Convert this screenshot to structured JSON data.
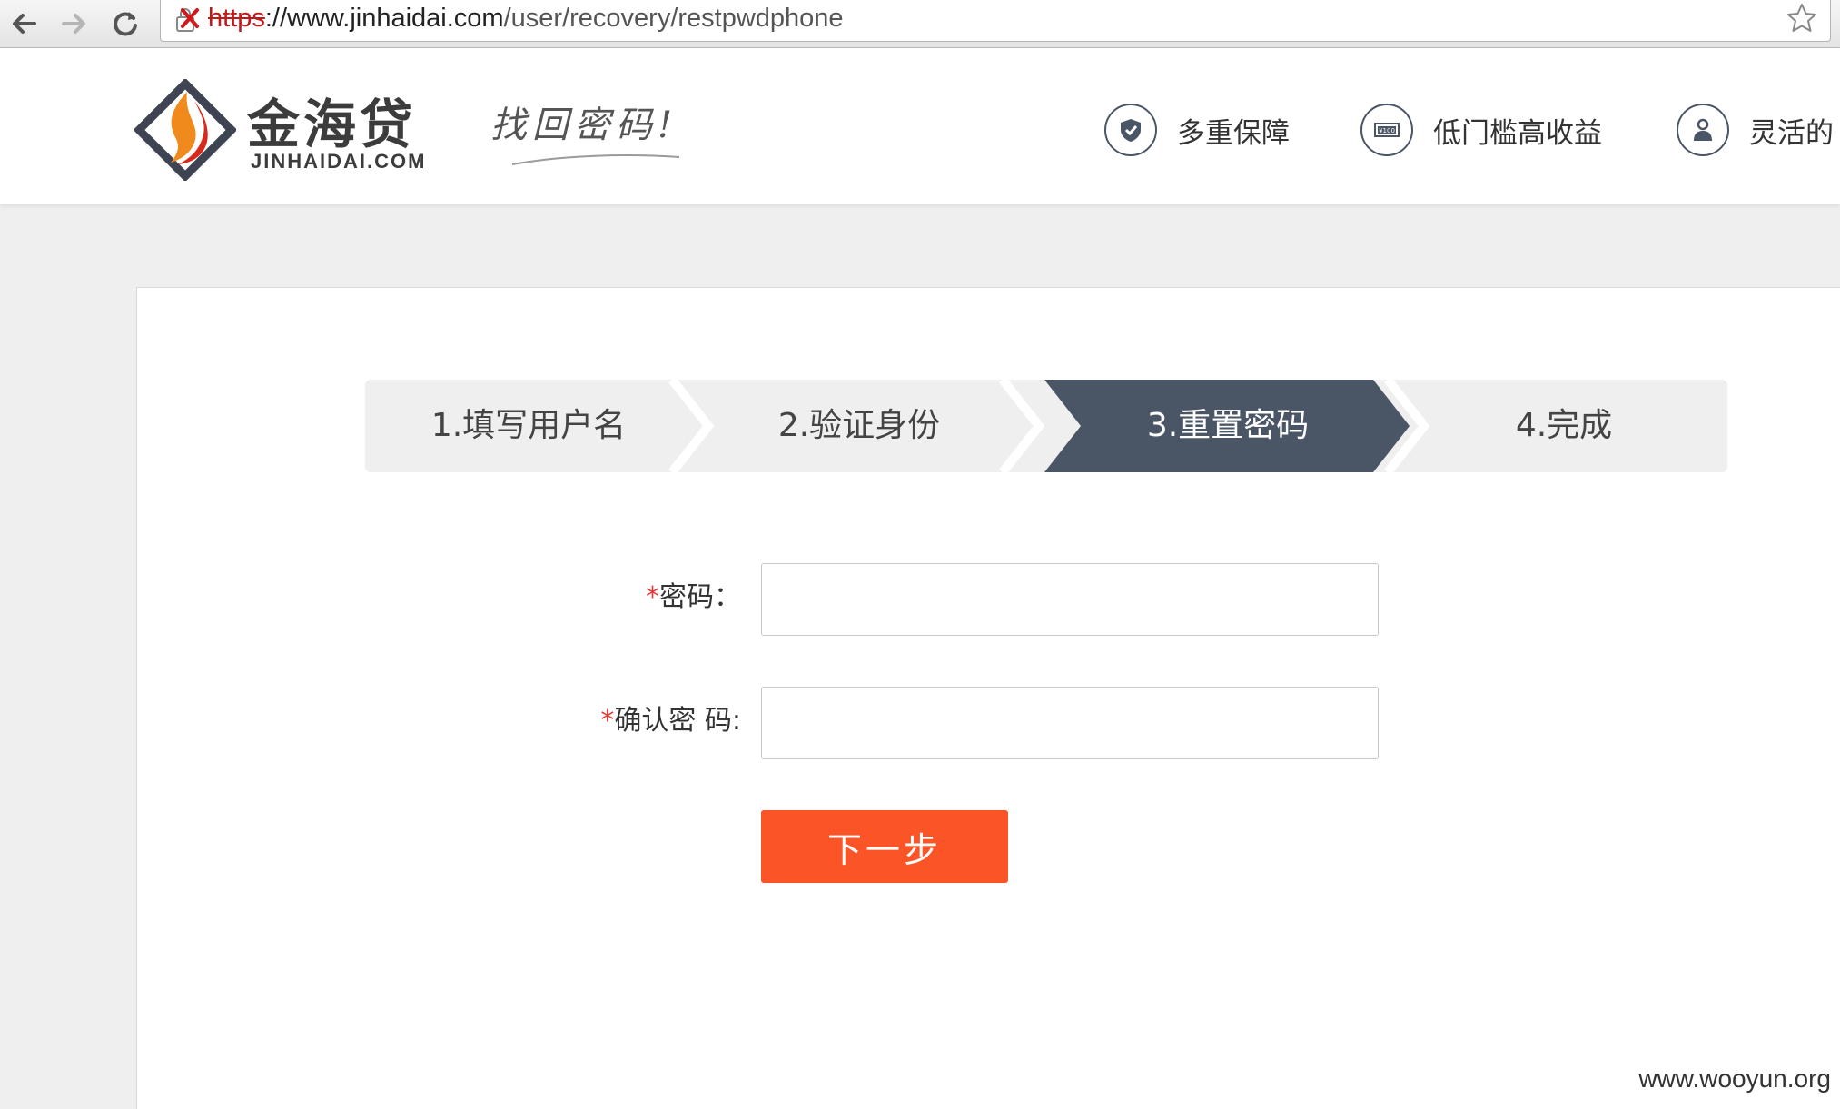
{
  "browser": {
    "url_scheme": "https",
    "url_host": "://www.jinhaidai.com",
    "url_path": "/user/recovery/restpwdphone"
  },
  "brand": {
    "name_cn": "金海贷",
    "name_en": "JINHAIDAI.COM",
    "slogan": "找回密码!"
  },
  "features": [
    {
      "label": "多重保障",
      "icon": "shield-check-icon"
    },
    {
      "label": "低门槛高收益",
      "icon": "money-bill-icon"
    },
    {
      "label": "灵活的",
      "icon": "person-icon"
    }
  ],
  "steps": [
    {
      "label": "1.填写用户名",
      "active": false
    },
    {
      "label": "2.验证身份",
      "active": false
    },
    {
      "label": "3.重置密码",
      "active": true
    },
    {
      "label": "4.完成",
      "active": false
    }
  ],
  "form": {
    "required_mark": "*",
    "password_label": "密码：",
    "password_value": "",
    "confirm_label": "确认密 码:",
    "confirm_value": "",
    "next_label": "下一步"
  },
  "watermark": "www.wooyun.org",
  "colors": {
    "accent_button": "#fb5426",
    "step_active": "#4a5566",
    "step_inactive": "#efefef",
    "required": "#e53935"
  }
}
